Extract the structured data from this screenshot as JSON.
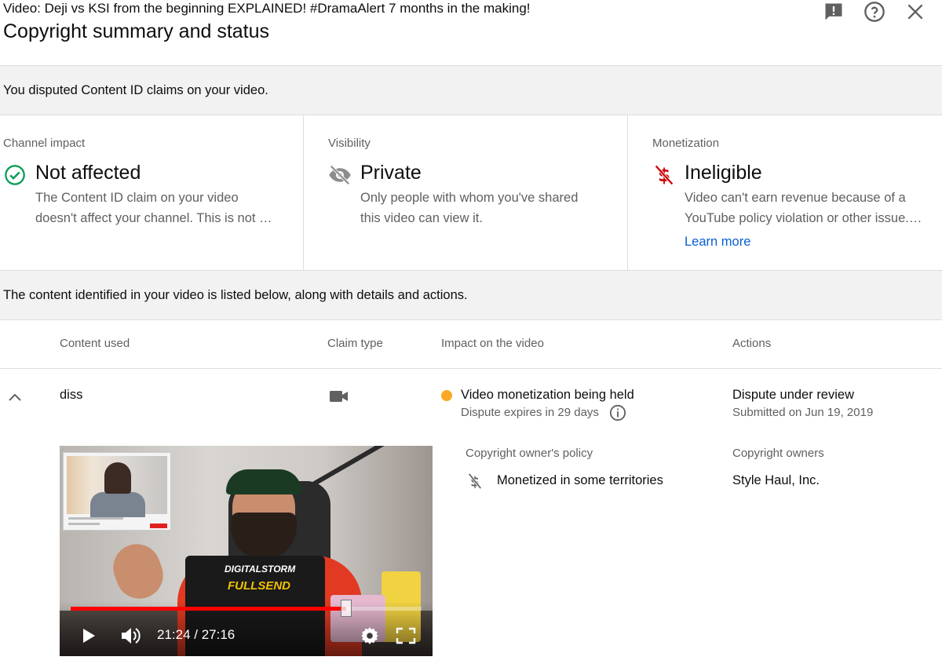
{
  "header": {
    "video_title": "Video: Deji vs KSI from the beginning EXPLAINED! #DramaAlert 7 months in the making!",
    "page_title": "Copyright summary and status",
    "icons": [
      "feedback-icon",
      "help-icon",
      "close-icon"
    ]
  },
  "dispute_banner": "You disputed Content ID claims on your video.",
  "cards": {
    "channel_impact": {
      "label": "Channel impact",
      "icon": "check-circle-icon",
      "status": "Not affected",
      "desc_line1": "The Content ID claim on your video",
      "desc_line2": "doesn't affect your channel. This is not …"
    },
    "visibility": {
      "label": "Visibility",
      "icon": "eye-off-icon",
      "status": "Private",
      "desc_line1": "Only people with whom you've shared",
      "desc_line2": "this video can view it."
    },
    "monetization": {
      "label": "Monetization",
      "icon": "no-dollar-icon",
      "status": "Ineligible",
      "desc_line1": "Video can't earn revenue because of a",
      "desc_line2": "YouTube policy violation or other issue.…",
      "link": "Learn more"
    }
  },
  "content_banner": "The content identified in your video is listed below, along with details and actions.",
  "table": {
    "headers": {
      "content_used": "Content used",
      "claim_type": "Claim type",
      "impact": "Impact on the video",
      "actions": "Actions"
    },
    "row": {
      "content": "diss",
      "claim_type_icon": "video-camera-icon",
      "impact_status": "Video monetization being held",
      "impact_sub": "Dispute expires in 29 days",
      "action_status": "Dispute under review",
      "action_sub": "Submitted on Jun 19, 2019"
    },
    "details": {
      "policy_label": "Copyright owner's policy",
      "policy_value": "Monetized in some territories",
      "owners_label": "Copyright owners",
      "owners_value": "Style Haul, Inc."
    }
  },
  "video_player": {
    "laptop_brand": "DIGITALSTORM",
    "laptop_text": "FULLSEND",
    "time": "21:24 / 27:16",
    "progress": 0.785
  },
  "colors": {
    "check": "#0f9d58",
    "no_dollar": "#cc0000",
    "status_dot": "#f9a825",
    "link": "#065fd4"
  }
}
